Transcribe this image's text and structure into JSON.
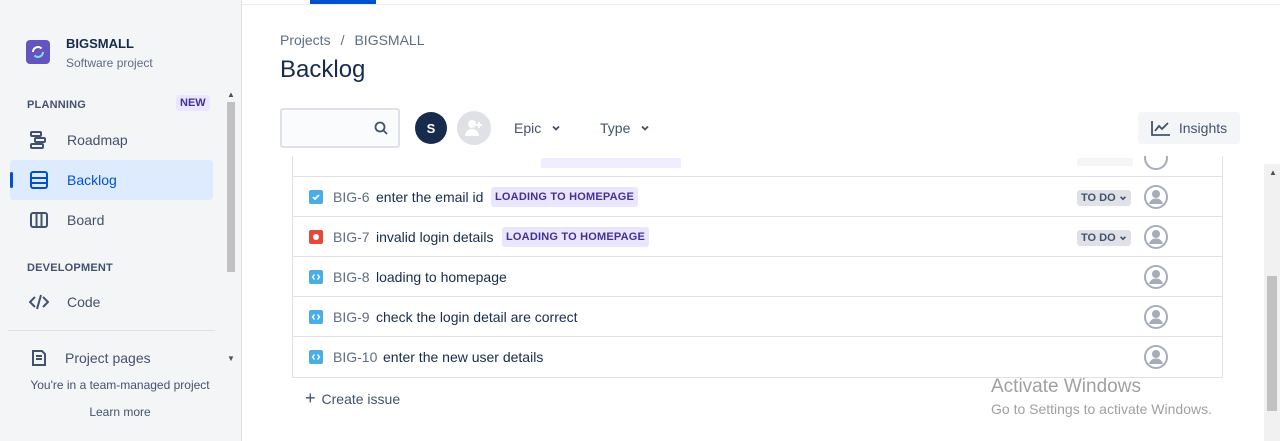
{
  "sidebar": {
    "project_name": "BIGSMALL",
    "project_type": "Software project",
    "planning_label": "PLANNING",
    "new_badge": "NEW",
    "nav": [
      {
        "label": "Roadmap",
        "icon": "roadmap-icon"
      },
      {
        "label": "Backlog",
        "icon": "backlog-icon",
        "active": true
      },
      {
        "label": "Board",
        "icon": "board-icon"
      }
    ],
    "development_label": "DEVELOPMENT",
    "code_label": "Code",
    "project_pages_label": "Project pages",
    "team_note": "You're in a team-managed project",
    "learn_more": "Learn more"
  },
  "header": {
    "breadcrumb": [
      "Projects",
      "/",
      "BIGSMALL"
    ],
    "title": "Backlog"
  },
  "toolbar": {
    "search_value": "",
    "avatar_initial": "S",
    "epic_label": "Epic",
    "type_label": "Type",
    "insights_label": "Insights"
  },
  "issues": [
    {
      "type": "task",
      "key": "BIG-6",
      "summary": "enter the email id",
      "epic": "LOADING TO HOMEPAGE",
      "status": "TO DO"
    },
    {
      "type": "bug",
      "key": "BIG-7",
      "summary": "invalid login details",
      "epic": "LOADING TO HOMEPAGE",
      "status": "TO DO"
    },
    {
      "type": "subtask",
      "key": "BIG-8",
      "summary": "loading to homepage",
      "epic": "",
      "status": ""
    },
    {
      "type": "subtask",
      "key": "BIG-9",
      "summary": "check the login detail are correct",
      "epic": "",
      "status": ""
    },
    {
      "type": "subtask",
      "key": "BIG-10",
      "summary": "enter the new user details",
      "epic": "",
      "status": ""
    }
  ],
  "create_issue_label": "Create issue",
  "watermark": {
    "line1": "Activate Windows",
    "line2": "Go to Settings to activate Windows."
  },
  "colors": {
    "accent": "#0052CC",
    "task": "#4BADE8",
    "bug": "#E5493A",
    "epic_bg": "#EAE6FF",
    "epic_fg": "#403294"
  }
}
